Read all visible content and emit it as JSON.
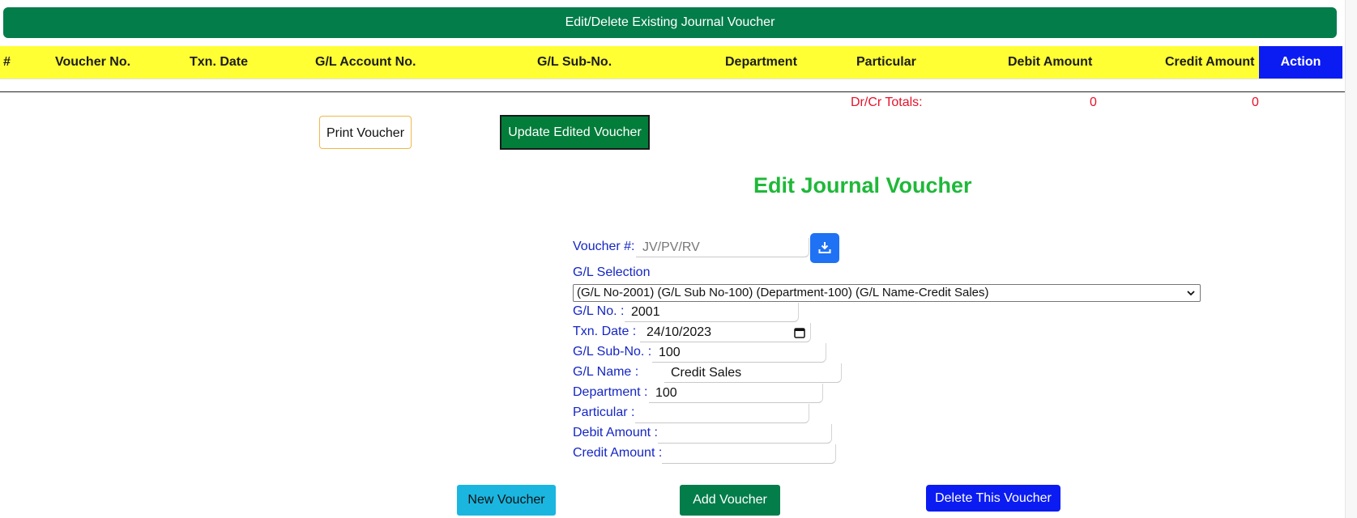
{
  "banner": {
    "title": "Edit/Delete Existing Journal Voucher"
  },
  "table": {
    "columns": [
      "#",
      "Voucher No.",
      "Txn. Date",
      "G/L Account No.",
      "G/L Sub-No.",
      "Department",
      "Particular",
      "Debit Amount",
      "Credit Amount"
    ],
    "action_label": "Action"
  },
  "totals": {
    "label": "Dr/Cr Totals:",
    "debit": "0",
    "credit": "0"
  },
  "buttons": {
    "print": "Print Voucher",
    "update": "Update Edited Voucher",
    "new": "New Voucher",
    "add": "Add Voucher",
    "delete": "Delete This Voucher"
  },
  "form": {
    "title": "Edit Journal Voucher",
    "voucher_label": "Voucher #:",
    "voucher_placeholder": "JV/PV/RV",
    "gl_selection_label": "G/L Selection",
    "gl_selection_value": "(G/L No-2001) (G/L Sub No-100) (Department-100) (G/L Name-Credit Sales)",
    "gl_no_label": "G/L No. :",
    "gl_no_value": "2001",
    "txn_date_label": "Txn. Date :",
    "txn_date_value": "24/10/2023",
    "gl_sub_label": "G/L Sub-No. :",
    "gl_sub_value": "100",
    "gl_name_label": "G/L Name :",
    "gl_name_value": "Credit Sales",
    "department_label": "Department :",
    "department_value": "100",
    "particular_label": "Particular :",
    "particular_value": "",
    "debit_label": "Debit Amount :",
    "debit_value": "",
    "credit_label": "Credit Amount :",
    "credit_value": ""
  },
  "icons": {
    "download": "download-icon",
    "calendar": "calendar-icon",
    "chevron": "chevron-down-icon"
  },
  "colors": {
    "banner": "#037d4a",
    "header": "#ffff33",
    "action": "#0b1cf2",
    "title": "#1fb839",
    "label": "#1526c4",
    "totals": "#e8122a",
    "new_button": "#1ab6e0",
    "download_button": "#1f72f4"
  }
}
